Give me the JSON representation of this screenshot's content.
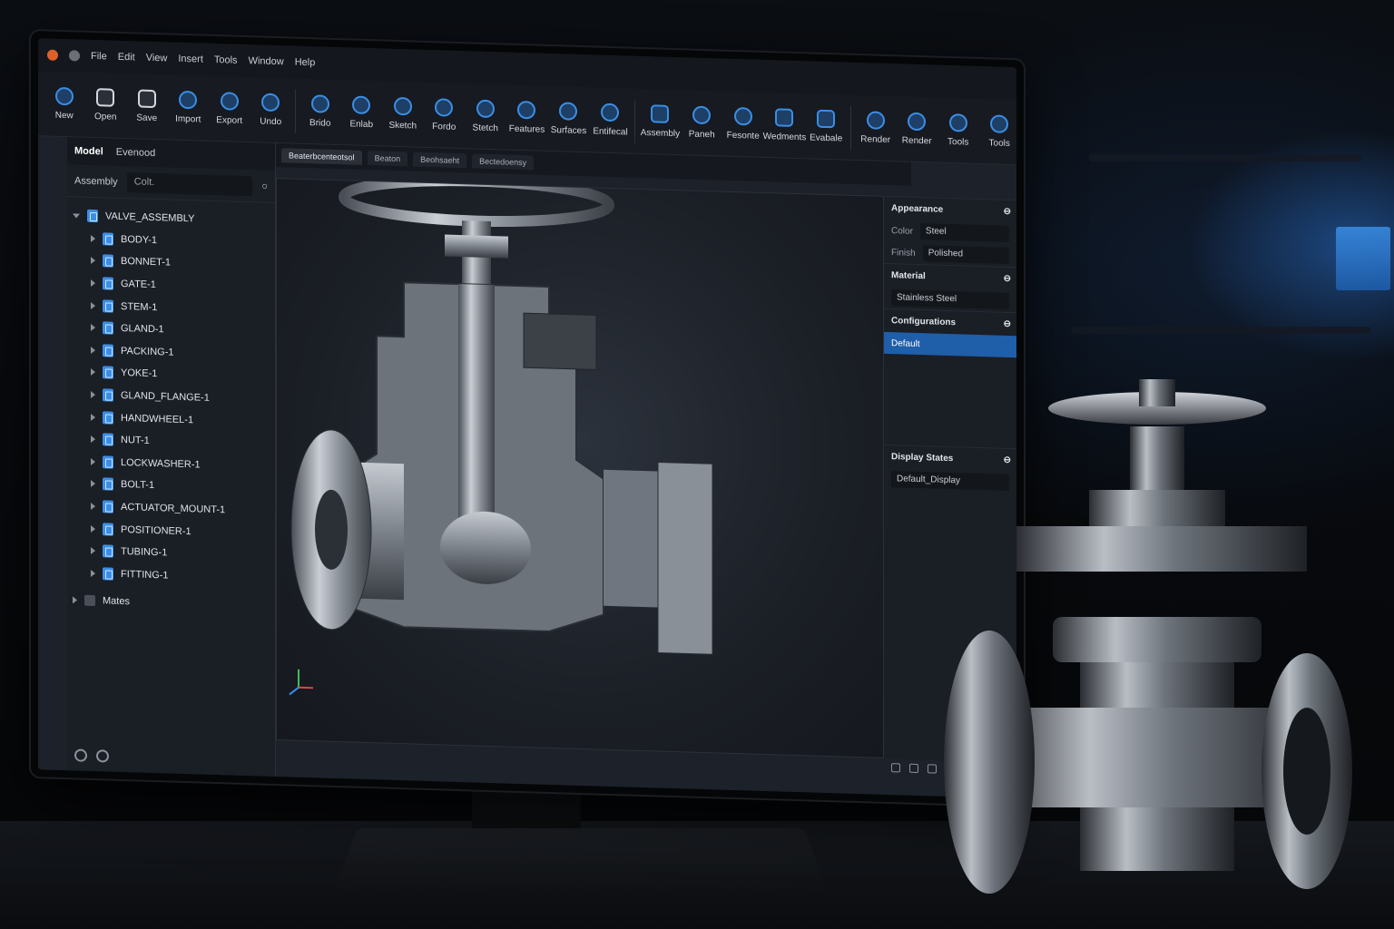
{
  "menu": [
    "File",
    "Edit",
    "View",
    "Insert",
    "Tools",
    "Window",
    "Help"
  ],
  "ribbon": [
    "New",
    "Open",
    "Save",
    "Import",
    "Export",
    "Undo",
    "Brido",
    "Enlab",
    "Sketch",
    "Fordo",
    "Stetch",
    "Features",
    "Surfaces",
    "Entifecal",
    "Assembly",
    "Paneh",
    "Fesonte",
    "Wedments",
    "Evabale",
    "Render",
    "Render",
    "Tools",
    "Tools"
  ],
  "left_panel": {
    "tabs": [
      "Model",
      "Evenood"
    ],
    "section": "Assembly",
    "search_value": "Colt.",
    "root": "VALVE_ASSEMBLY",
    "parts": [
      "BODY-1",
      "BONNET-1",
      "GATE-1",
      "STEM-1",
      "GLAND-1",
      "PACKING-1",
      "YOKE-1",
      "GLAND_FLANGE-1",
      "HANDWHEEL-1",
      "NUT-1",
      "LOCKWASHER-1",
      "BOLT-1",
      "ACTUATOR_MOUNT-1",
      "POSITIONER-1",
      "TUBING-1",
      "FITTING-1"
    ],
    "mates": "Mates"
  },
  "doc_tabs": [
    "Beaterbcenteotsol",
    "Beaton",
    "Beohsaeht",
    "Bectedoensy"
  ],
  "right_panel": {
    "appearance": "Appearance",
    "color_label": "Color",
    "color_value": "Steel",
    "finish_label": "Finish",
    "finish_value": "Polished",
    "material": "Material",
    "material_value": "Stainless Steel",
    "configurations": "Configurations",
    "config_value": "Default",
    "display_states": "Display States",
    "display_value": "Default_Display"
  },
  "colors": {
    "accent": "#3a8ee6",
    "selection": "#1f5ea8",
    "panel": "#1a1e25",
    "steel": "#8d939b"
  }
}
